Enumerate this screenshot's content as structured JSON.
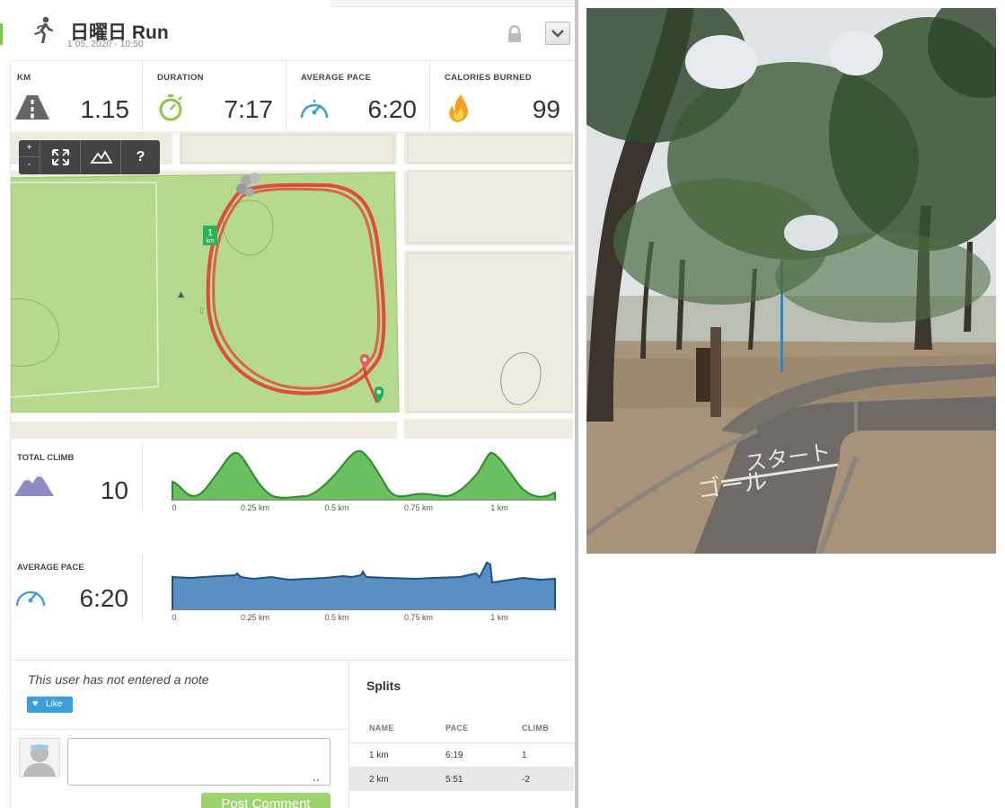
{
  "header": {
    "title": "日曜日 Run",
    "subtitle": "1 05, 2020  -  10:50"
  },
  "stats": [
    {
      "label": "KM",
      "value": "1.15",
      "icon": "road-icon"
    },
    {
      "label": "DURATION",
      "value": "7:17",
      "icon": "stopwatch-icon"
    },
    {
      "label": "AVERAGE PACE",
      "value": "6:20",
      "icon": "speedometer-icon"
    },
    {
      "label": "CALORIES BURNED",
      "value": "99",
      "icon": "flame-icon"
    }
  ],
  "map": {
    "zoom_in": "+",
    "zoom_out": "-",
    "help": "?",
    "km_marker": "1",
    "km_marker_unit": "km"
  },
  "climb": {
    "label": "TOTAL CLIMB",
    "value": "10",
    "x_ticks": [
      "0",
      "0.25 km",
      "0.5 km",
      "0.75 km",
      "1 km"
    ]
  },
  "pace": {
    "label": "AVERAGE PACE",
    "value": "6:20",
    "x_ticks": [
      "0",
      "0.25 km",
      "0.5 km",
      "0.75 km",
      "1 km"
    ]
  },
  "notes": {
    "note": "This user has not entered a note",
    "like": "Like",
    "post_comment": "Post Comment"
  },
  "splits": {
    "title": "Splits",
    "columns": [
      "NAME",
      "PACE",
      "CLIMB"
    ],
    "rows": [
      {
        "name": "1 km",
        "pace": "6:19",
        "climb": "1"
      },
      {
        "name": "2 km",
        "pace": "5:51",
        "climb": "-2"
      }
    ]
  },
  "colors": {
    "accent_green": "#7ac943",
    "route_red": "#e8312f",
    "climb_fill": "#6abf5e",
    "pace_fill": "#5a8fc4",
    "like_blue": "#3aa0dc"
  }
}
